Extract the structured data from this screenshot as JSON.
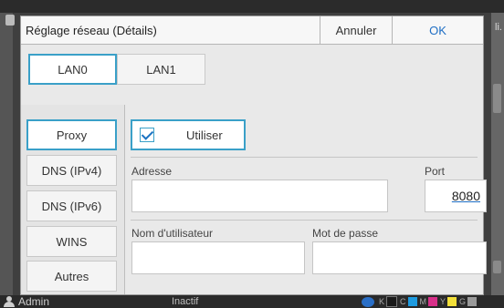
{
  "dialog": {
    "title": "Réglage réseau (Détails)",
    "cancel_label": "Annuler",
    "ok_label": "OK"
  },
  "tabs": [
    {
      "label": "LAN0",
      "selected": true
    },
    {
      "label": "LAN1",
      "selected": false
    }
  ],
  "nav": [
    {
      "label": "Proxy",
      "selected": true
    },
    {
      "label": "DNS (IPv4)",
      "selected": false
    },
    {
      "label": "DNS (IPv6)",
      "selected": false
    },
    {
      "label": "WINS",
      "selected": false
    },
    {
      "label": "Autres",
      "selected": false
    }
  ],
  "proxy": {
    "use_label": "Utiliser",
    "use_checked": true,
    "address_label": "Adresse",
    "address_value": "",
    "port_label": "Port",
    "port_value": "8080",
    "username_label": "Nom d'utilisateur",
    "username_value": "",
    "password_label": "Mot de passe",
    "password_value": ""
  },
  "background": {
    "right_text": "li."
  },
  "status": {
    "user": "Admin",
    "state": "Inactif",
    "inks": [
      {
        "label": "K",
        "color": "#1a1a1a"
      },
      {
        "label": "C",
        "color": "#1e9be0"
      },
      {
        "label": "M",
        "color": "#d8308a"
      },
      {
        "label": "Y",
        "color": "#f3e03a"
      },
      {
        "label": "G",
        "color": "#9a9a9a"
      }
    ]
  },
  "colors": {
    "accent": "#3aa0c8",
    "ok_text": "#1e6ec4"
  }
}
